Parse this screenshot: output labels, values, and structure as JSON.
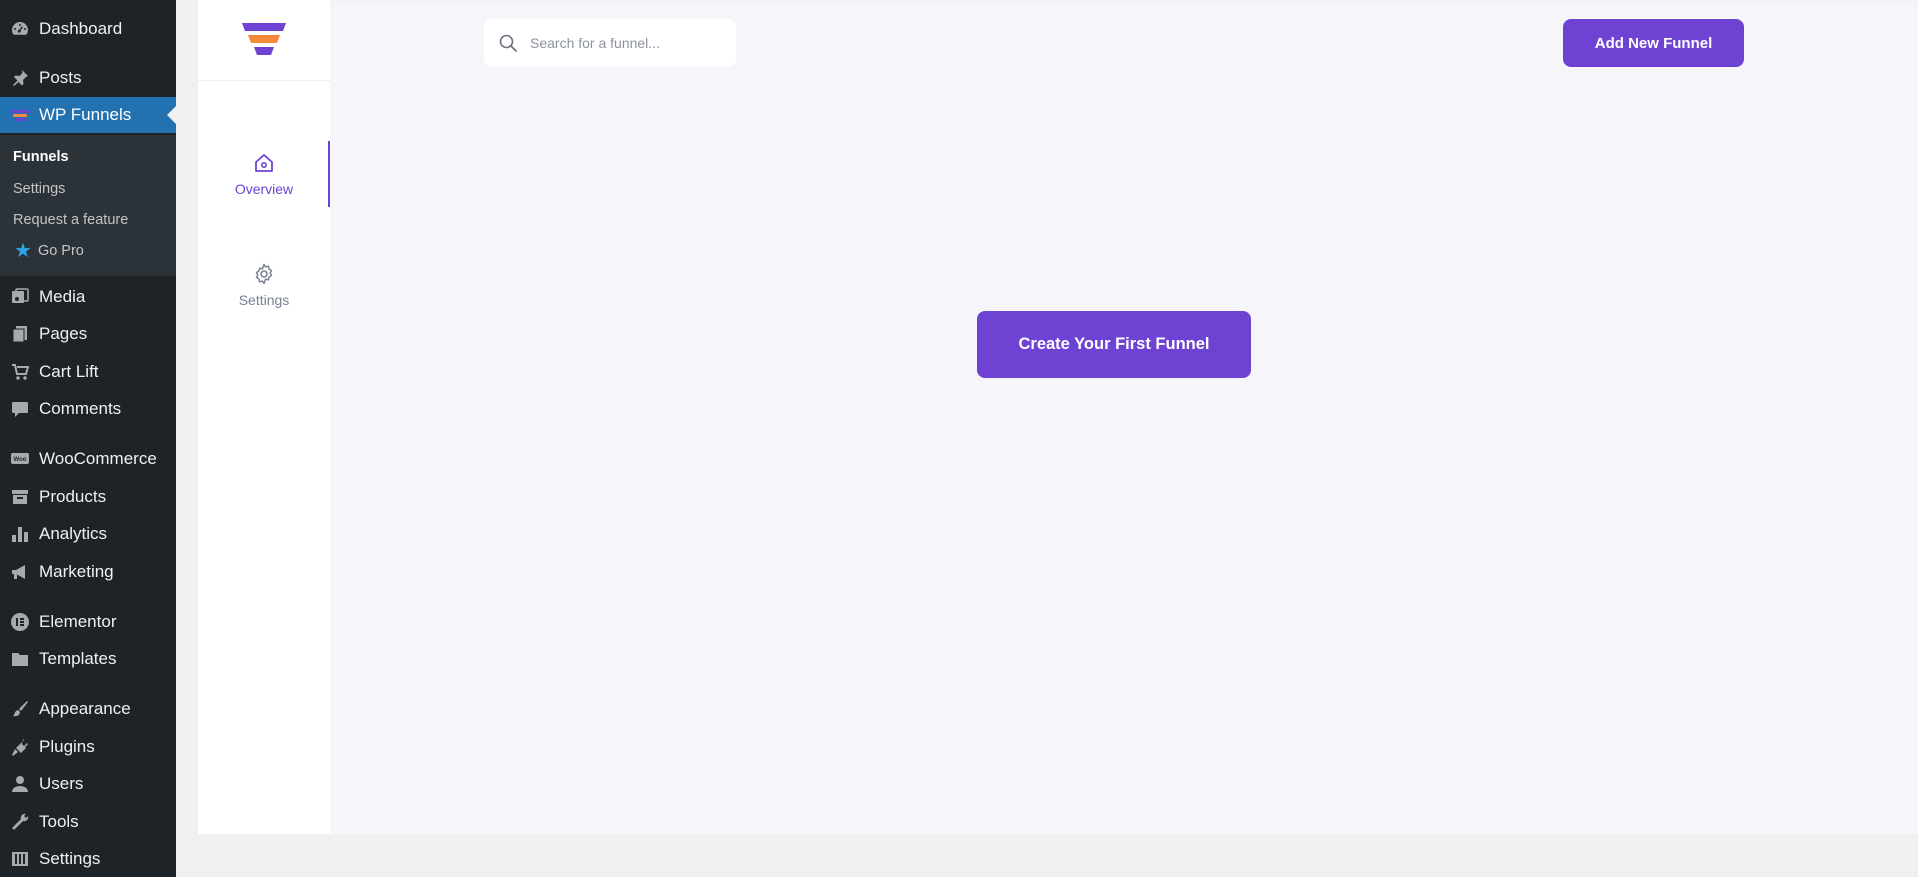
{
  "admin_menu": {
    "items": [
      {
        "label": "Dashboard",
        "icon": "dashboard-icon"
      },
      {
        "label": "Posts",
        "icon": "pin-icon"
      },
      {
        "label": "WP Funnels",
        "icon": "wp-funnels-icon",
        "current": true
      },
      {
        "label": "Media",
        "icon": "media-icon"
      },
      {
        "label": "Pages",
        "icon": "pages-icon"
      },
      {
        "label": "Cart Lift",
        "icon": "cart-icon"
      },
      {
        "label": "Comments",
        "icon": "comment-icon"
      },
      {
        "label": "WooCommerce",
        "icon": "woocommerce-icon"
      },
      {
        "label": "Products",
        "icon": "archive-icon"
      },
      {
        "label": "Analytics",
        "icon": "bar-chart-icon"
      },
      {
        "label": "Marketing",
        "icon": "megaphone-icon"
      },
      {
        "label": "Elementor",
        "icon": "elementor-icon"
      },
      {
        "label": "Templates",
        "icon": "folder-icon"
      },
      {
        "label": "Appearance",
        "icon": "brush-icon"
      },
      {
        "label": "Plugins",
        "icon": "plug-icon"
      },
      {
        "label": "Users",
        "icon": "user-icon"
      },
      {
        "label": "Tools",
        "icon": "wrench-icon"
      },
      {
        "label": "Settings",
        "icon": "settings-sliders-icon"
      }
    ],
    "submenu": [
      {
        "label": "Funnels",
        "current": true
      },
      {
        "label": "Settings"
      },
      {
        "label": "Request a feature"
      },
      {
        "label": "Go Pro",
        "icon": "star-icon"
      }
    ]
  },
  "plugin_nav": {
    "tabs": [
      {
        "label": "Overview",
        "icon": "home-icon",
        "active": true
      },
      {
        "label": "Settings",
        "icon": "gear-icon"
      }
    ]
  },
  "main": {
    "search_placeholder": "Search for a funnel...",
    "add_button": "Add New Funnel",
    "create_button": "Create Your First Funnel"
  },
  "colors": {
    "accent": "#6e42d3",
    "admin_bg": "#1d2327",
    "admin_current": "#2271b1",
    "funnel_logo_orange": "#f48a3a"
  }
}
